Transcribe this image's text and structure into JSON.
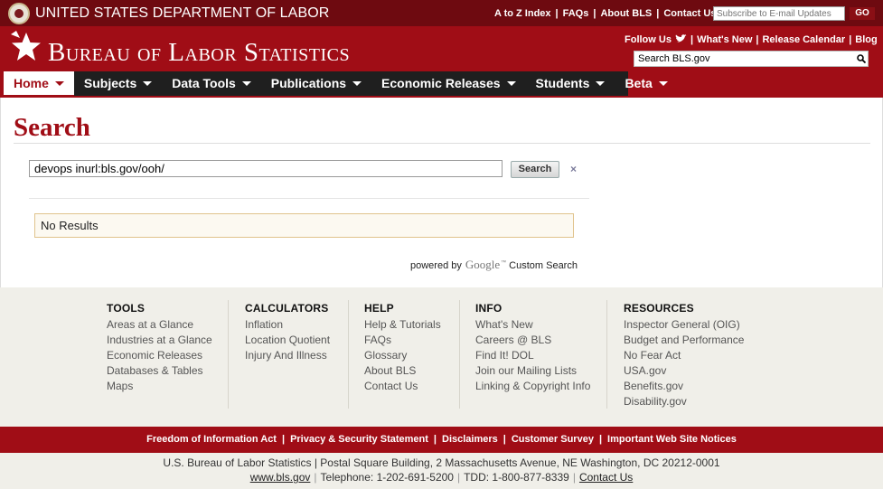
{
  "dol_bar": {
    "title": "UNITED STATES DEPARTMENT OF LABOR",
    "links": [
      "A to Z Index",
      "FAQs",
      "About BLS",
      "Contact Us"
    ],
    "subscribe_placeholder": "Subscribe to E-mail Updates",
    "go_label": "GO"
  },
  "header": {
    "agency_name": "Bureau of Labor Statistics",
    "follow_us": "Follow Us",
    "links": [
      "What's New",
      "Release Calendar",
      "Blog"
    ],
    "search_value": "Search BLS.gov"
  },
  "nav": {
    "items": [
      {
        "label": "Home",
        "active": true
      },
      {
        "label": "Subjects"
      },
      {
        "label": "Data Tools"
      },
      {
        "label": "Publications"
      },
      {
        "label": "Economic Releases"
      },
      {
        "label": "Students"
      },
      {
        "label": "Beta"
      }
    ]
  },
  "main": {
    "title": "Search",
    "query": "devops inurl:bls.gov/ooh/",
    "search_button": "Search",
    "clear_symbol": "×",
    "results_message": "No Results",
    "powered_by": "powered by",
    "google": "Google",
    "tm": "™",
    "custom_search": "Custom Search"
  },
  "footer": {
    "columns": [
      {
        "heading": "TOOLS",
        "items": [
          "Areas at a Glance",
          "Industries at a Glance",
          "Economic Releases",
          "Databases & Tables",
          "Maps"
        ]
      },
      {
        "heading": "CALCULATORS",
        "items": [
          "Inflation",
          "Location Quotient",
          "Injury And Illness"
        ]
      },
      {
        "heading": "HELP",
        "items": [
          "Help & Tutorials",
          "FAQs",
          "Glossary",
          "About BLS",
          "Contact Us"
        ]
      },
      {
        "heading": "INFO",
        "items": [
          "What's New",
          "Careers @ BLS",
          "Find It! DOL",
          "Join our Mailing Lists",
          "Linking & Copyright Info"
        ]
      },
      {
        "heading": "RESOURCES",
        "items": [
          "Inspector General (OIG)",
          "Budget and Performance",
          "No Fear Act",
          "USA.gov",
          "Benefits.gov",
          "Disability.gov"
        ]
      }
    ],
    "bar_links": [
      "Freedom of Information Act",
      "Privacy & Security Statement",
      "Disclaimers",
      "Customer Survey",
      "Important Web Site Notices"
    ],
    "address": "U.S. Bureau of Labor Statistics | Postal Square Building, 2 Massachusetts Avenue, NE Washington, DC 20212-0001",
    "site": "www.bls.gov",
    "telephone": "Telephone: 1-202-691-5200",
    "tdd": "TDD: 1-800-877-8339",
    "contact": "Contact Us"
  },
  "colors": {
    "dol_bar": "#6e0a10",
    "bls_red": "#a00d16",
    "nav_dark": "#1f1f1f",
    "footer_bg": "#f0efe9"
  }
}
